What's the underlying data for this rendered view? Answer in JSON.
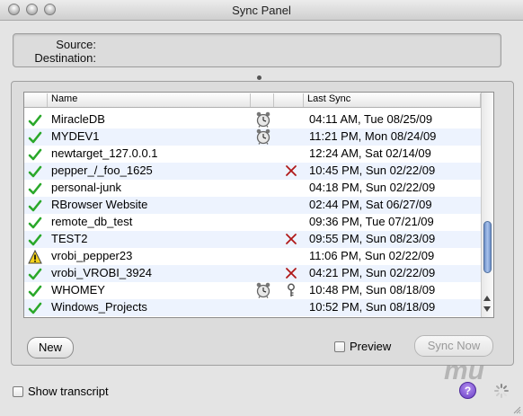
{
  "window": {
    "title": "Sync Panel"
  },
  "info": {
    "source_label": "Source:",
    "destination_label": "Destination:"
  },
  "table": {
    "columns": [
      "Name",
      "Last Sync"
    ],
    "rows": [
      {
        "status": "ok",
        "name": "MiracleDB",
        "clock": true,
        "flag": "",
        "last_sync": "04:11 AM, Tue 08/25/09"
      },
      {
        "status": "ok",
        "name": "MYDEV1",
        "clock": true,
        "flag": "",
        "last_sync": "11:21 PM, Mon 08/24/09"
      },
      {
        "status": "ok",
        "name": "newtarget_127.0.0.1",
        "clock": false,
        "flag": "",
        "last_sync": "12:24 AM, Sat 02/14/09"
      },
      {
        "status": "ok",
        "name": "pepper_/_foo_1625",
        "clock": false,
        "flag": "x",
        "last_sync": "10:45 PM, Sun 02/22/09"
      },
      {
        "status": "ok",
        "name": "personal-junk",
        "clock": false,
        "flag": "",
        "last_sync": "04:18 PM, Sun 02/22/09"
      },
      {
        "status": "ok",
        "name": "RBrowser Website",
        "clock": false,
        "flag": "",
        "last_sync": "02:44 PM, Sat 06/27/09"
      },
      {
        "status": "ok",
        "name": "remote_db_test",
        "clock": false,
        "flag": "",
        "last_sync": "09:36 PM, Tue 07/21/09"
      },
      {
        "status": "ok",
        "name": "TEST2",
        "clock": false,
        "flag": "x",
        "last_sync": "09:55 PM, Sun 08/23/09"
      },
      {
        "status": "warn",
        "name": "vrobi_pepper23",
        "clock": false,
        "flag": "",
        "last_sync": "11:06 PM, Sun 02/22/09"
      },
      {
        "status": "ok",
        "name": "vrobi_VROBI_3924",
        "clock": false,
        "flag": "x",
        "last_sync": "04:21 PM, Sun 02/22/09"
      },
      {
        "status": "ok",
        "name": "WHOMEY",
        "clock": true,
        "flag": "key",
        "last_sync": "10:48 PM, Sun 08/18/09"
      },
      {
        "status": "ok",
        "name": "Windows_Projects",
        "clock": false,
        "flag": "",
        "last_sync": "10:52 PM, Sun 08/18/09"
      }
    ]
  },
  "buttons": {
    "new": "New",
    "sync_now": "Sync Now"
  },
  "preview": {
    "label": "Preview",
    "checked": false
  },
  "transcript": {
    "label": "Show transcript",
    "checked": false
  },
  "help": {
    "label": "?"
  },
  "logo": {
    "text": "mu"
  },
  "colors": {
    "ok": "#2aa82a",
    "x": "#b01818",
    "row_alt": "#edf3fe",
    "scroll_thumb": "#7fa0d8",
    "help": "#6a3ec6"
  },
  "icons": {
    "ok": "checkmark-icon",
    "warn": "warning-icon",
    "clock": "alarm-clock-icon",
    "x": "x-mark-icon",
    "key": "key-icon"
  }
}
